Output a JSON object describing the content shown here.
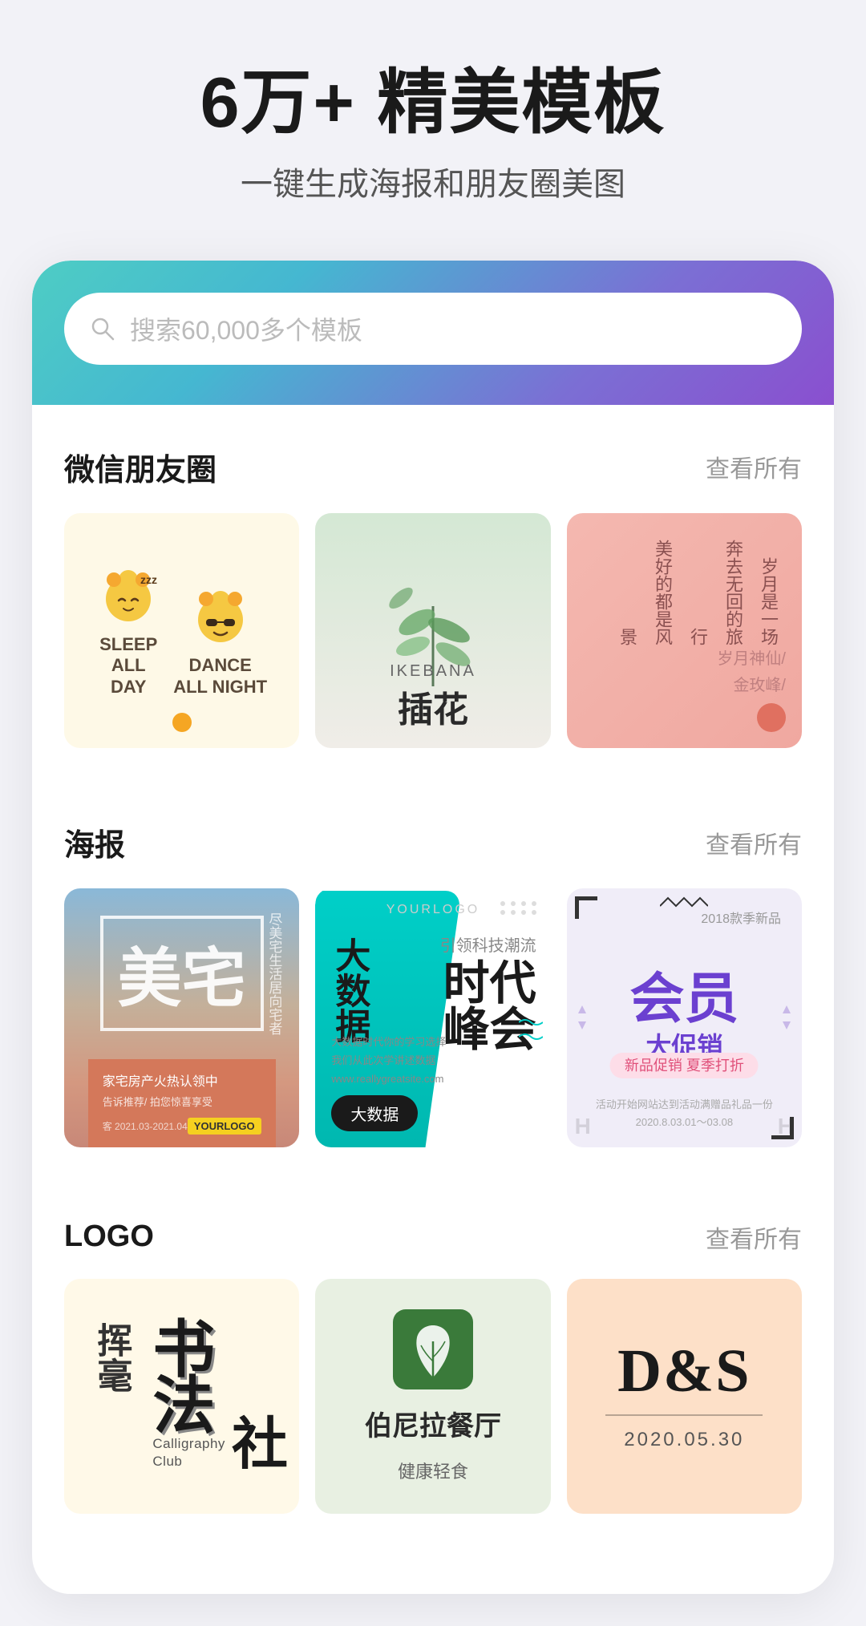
{
  "hero": {
    "title": "6万+ 精美模板",
    "subtitle": "一键生成海报和朋友圈美图"
  },
  "search": {
    "placeholder": "搜索60,000多个模板"
  },
  "sections": {
    "wechat": {
      "title": "微信朋友圈",
      "more": "查看所有"
    },
    "poster": {
      "title": "海报",
      "more": "查看所有"
    },
    "logo": {
      "title": "LOGO",
      "more": "查看所有"
    }
  },
  "wechat_cards": {
    "card1": {
      "line1": "SLEEP",
      "line2": "ALL",
      "line3": "DAY",
      "line4": "DANCE",
      "line5": "ALL NIGHT"
    },
    "card2": {
      "en": "IKEBANA",
      "cn": "插花"
    },
    "card3": {
      "lines": [
        "岁月是一场",
        "奔去无回的旅行",
        "美好的都是风景"
      ],
      "author1": "岁月神仙/",
      "author2": "金玫峰/"
    }
  },
  "poster_cards": {
    "card1": {
      "title": "美宅",
      "side_text": "尽美宅生活居向宅者",
      "bottom1": "家宅房产火热认领中",
      "bottom2": "告诉推荐/拍您惊喜享受",
      "bottom3": "客 YOURLOGO",
      "date": "客 2021.03-2021.04.01"
    },
    "card2": {
      "logo": "YOURLOGO",
      "lead": "引领科技潮流",
      "title": "时代峰会",
      "subtitle": "大数据",
      "btn": "大数据",
      "url": "www.reallygreatsite.com"
    },
    "card3": {
      "year": "2018款季新品",
      "product": "新品促销 夏季打折",
      "title": "会员",
      "subtitle": "大促销",
      "promo": "新品促销 夏季打折",
      "desc": "活动开始网站达到活动满赠品礼品一份\n2020.2021.03.01～03.08"
    }
  },
  "logo_cards": {
    "card1": {
      "brush": "挥",
      "cn_main": "书法",
      "en1": "Calligraphy",
      "en2": "Club",
      "cn2": "社"
    },
    "card2": {
      "name": "伯尼拉餐厅",
      "type": "健康轻食"
    },
    "card3": {
      "logo": "D&S",
      "date": "2020.05.30"
    }
  }
}
